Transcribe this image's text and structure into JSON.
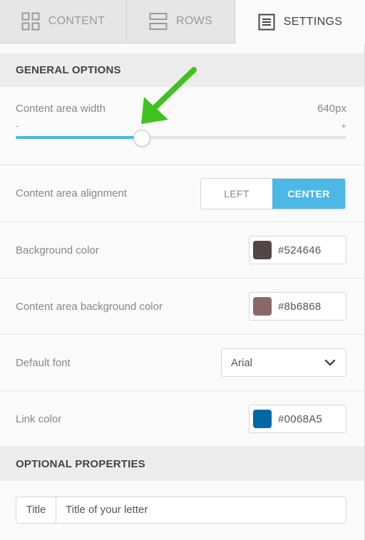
{
  "tabs": [
    {
      "label": "CONTENT",
      "icon": "grid-icon"
    },
    {
      "label": "ROWS",
      "icon": "rows-icon"
    },
    {
      "label": "SETTINGS",
      "icon": "settings-doc-icon"
    }
  ],
  "general": {
    "header": "GENERAL OPTIONS",
    "width": {
      "label": "Content area width",
      "value": "640px",
      "minus": "-",
      "plus": "+",
      "slider_fraction": 0.38
    },
    "alignment": {
      "label": "Content area alignment",
      "options": [
        "LEFT",
        "CENTER"
      ],
      "selected": "CENTER"
    },
    "background_color": {
      "label": "Background color",
      "value": "#524646",
      "swatch": "#524646"
    },
    "content_background_color": {
      "label": "Content area background color",
      "value": "#8b6868",
      "swatch": "#8b6868"
    },
    "default_font": {
      "label": "Default font",
      "value": "Arial"
    },
    "link_color": {
      "label": "Link color",
      "value": "#0068A5",
      "swatch": "#0068A5"
    }
  },
  "optional": {
    "header": "OPTIONAL PROPERTIES",
    "title": {
      "label": "Title",
      "placeholder": "Title of your letter"
    }
  },
  "colors": {
    "accent": "#4bb8e6",
    "arrow": "#3fc21f"
  }
}
